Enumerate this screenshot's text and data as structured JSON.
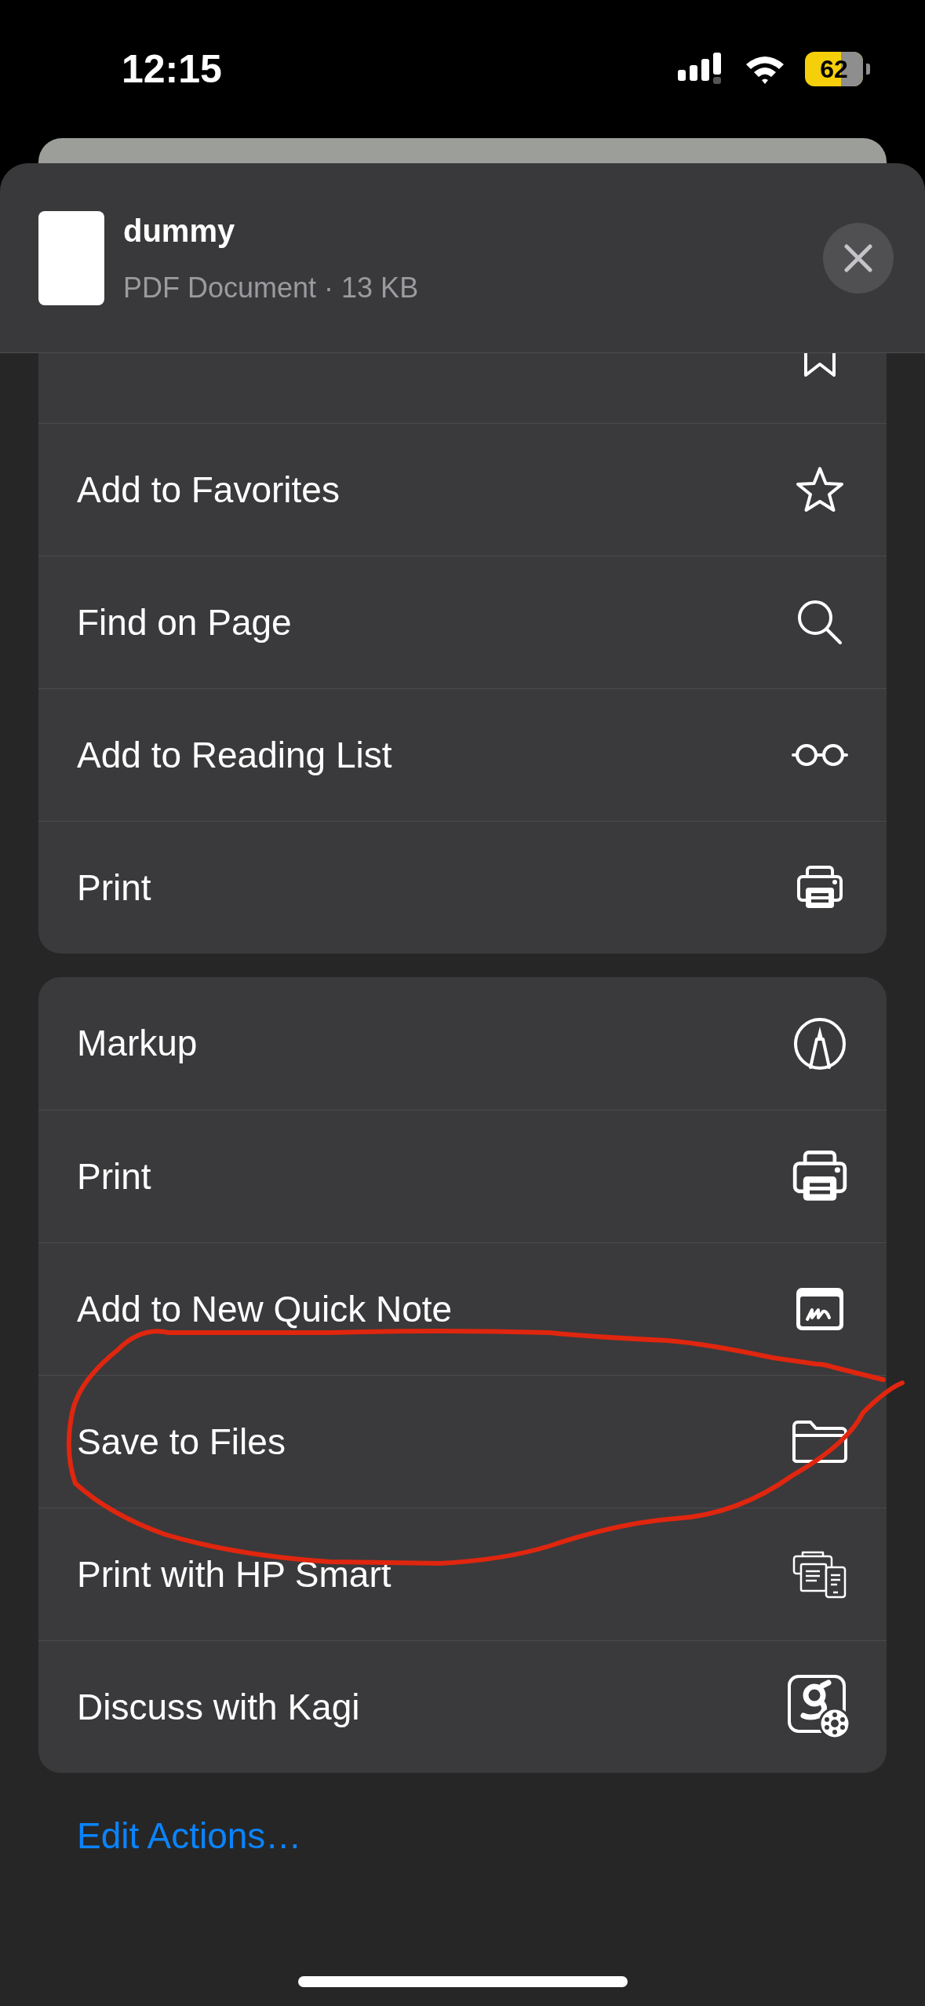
{
  "status_bar": {
    "time": "12:15",
    "battery_text": "62"
  },
  "file": {
    "name": "dummy",
    "subtitle": "PDF Document · 13 KB"
  },
  "action_groups": [
    {
      "items": [
        {
          "kind": "bookmark"
        },
        {
          "label": "Add to Favorites",
          "kind": "star"
        },
        {
          "label": "Find on Page",
          "kind": "search"
        },
        {
          "label": "Add to Reading List",
          "kind": "glasses"
        },
        {
          "label": "Print",
          "kind": "printer-small"
        }
      ]
    },
    {
      "items": [
        {
          "label": "Markup",
          "kind": "pen"
        },
        {
          "label": "Print",
          "kind": "printer"
        },
        {
          "label": "Add to New Quick Note",
          "kind": "note"
        },
        {
          "label": "Save to Files",
          "kind": "folder"
        },
        {
          "label": "Print with HP Smart",
          "kind": "hp"
        },
        {
          "label": "Discuss with Kagi",
          "kind": "kagi"
        }
      ]
    }
  ],
  "edit_actions": "Edit Actions…",
  "annotation": {
    "kind": "freehand-loop",
    "color": "#e0260f"
  }
}
